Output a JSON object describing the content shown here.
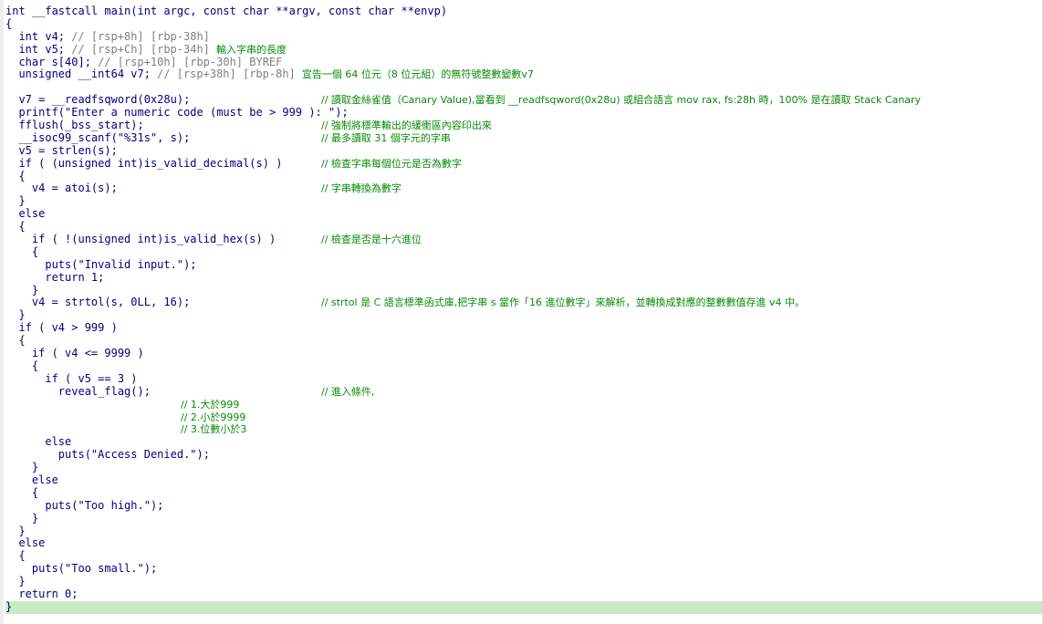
{
  "editor": {
    "lines": [
      {
        "code": "int __fastcall main(int argc, const char **argv, const char **envp)",
        "comment": ""
      },
      {
        "code": "{",
        "comment": ""
      },
      {
        "code": "  int v4; ",
        "gray": "// [rsp+8h] [rbp-38h]",
        "comment": ""
      },
      {
        "code": "  int v5; ",
        "gray": "// [rsp+Ch] [rbp-34h] ",
        "comment": "輸入字串的長度"
      },
      {
        "code": "  char s[40]; ",
        "gray": "// [rsp+10h] [rbp-30h] BYREF",
        "comment": ""
      },
      {
        "code": "  unsigned __int64 v7; ",
        "gray": "// [rsp+38h] [rbp-8h] ",
        "comment": "宣告一個 64 位元（8 位元組）的無符號整數變數v7"
      },
      {
        "code": "",
        "comment": ""
      },
      {
        "code": "  v7 = __readfsqword(0x28u);",
        "comment": "// 讀取金絲雀值（Canary Value),當看到 __readfsqword(0x28u) 或組合語言 mov rax, fs:28h 時，100% 是在讀取 Stack Canary"
      },
      {
        "code": "  printf(\"Enter a numeric code (must be > 999 ): \");",
        "comment": ""
      },
      {
        "code": "  fflush(_bss_start);",
        "comment": "// 強制將標準輸出的緩衝區內容印出來"
      },
      {
        "code": "  __isoc99_scanf(\"%31s\", s);",
        "comment": "// 最多讀取 31 個字元的字串"
      },
      {
        "code": "  v5 = strlen(s);",
        "comment": ""
      },
      {
        "code": "  if ( (unsigned int)is_valid_decimal(s) )",
        "comment": "// 檢查字串每個位元是否為數字"
      },
      {
        "code": "  {",
        "comment": ""
      },
      {
        "code": "    v4 = atoi(s);",
        "comment": "// 字串轉換為數字"
      },
      {
        "code": "  }",
        "comment": ""
      },
      {
        "code": "  else",
        "comment": ""
      },
      {
        "code": "  {",
        "comment": ""
      },
      {
        "code": "    if ( !(unsigned int)is_valid_hex(s) )",
        "comment": "// 檢查是否是十六進位"
      },
      {
        "code": "    {",
        "comment": ""
      },
      {
        "code": "      puts(\"Invalid input.\");",
        "comment": ""
      },
      {
        "code": "      return 1;",
        "comment": ""
      },
      {
        "code": "    }",
        "comment": ""
      },
      {
        "code": "    v4 = strtol(s, 0LL, 16);",
        "comment": "// strtol 是 C 語言標準函式庫,把字串 s 當作「16 進位數字」來解析，並轉換成對應的整數數值存進 v4 中。"
      },
      {
        "code": "  }",
        "comment": ""
      },
      {
        "code": "  if ( v4 > 999 )",
        "comment": ""
      },
      {
        "code": "  {",
        "comment": ""
      },
      {
        "code": "    if ( v4 <= 9999 )",
        "comment": ""
      },
      {
        "code": "    {",
        "comment": ""
      },
      {
        "code": "      if ( v5 == 3 )",
        "comment": ""
      },
      {
        "code": "        reveal_flag();",
        "comment": "// 進入條件,"
      },
      {
        "code": "",
        "comment2": "// 1.大於999"
      },
      {
        "code": "",
        "comment2": "// 2.小於9999"
      },
      {
        "code": "",
        "comment2": "// 3.位數小於3"
      },
      {
        "code": "      else",
        "comment": ""
      },
      {
        "code": "        puts(\"Access Denied.\");",
        "comment": ""
      },
      {
        "code": "    }",
        "comment": ""
      },
      {
        "code": "    else",
        "comment": ""
      },
      {
        "code": "    {",
        "comment": ""
      },
      {
        "code": "      puts(\"Too high.\");",
        "comment": ""
      },
      {
        "code": "    }",
        "comment": ""
      },
      {
        "code": "  }",
        "comment": ""
      },
      {
        "code": "  else",
        "comment": ""
      },
      {
        "code": "  {",
        "comment": ""
      },
      {
        "code": "    puts(\"Too small.\");",
        "comment": ""
      },
      {
        "code": "  }",
        "comment": ""
      },
      {
        "code": "  return 0;",
        "comment": ""
      },
      {
        "code": "}",
        "comment": ""
      }
    ],
    "highlighted_line": 47,
    "colors": {
      "keyword": "#000080",
      "comment": "#0a8a0a",
      "gray_var": "#7f7f7f",
      "highlight": "#c9ebc3"
    }
  }
}
